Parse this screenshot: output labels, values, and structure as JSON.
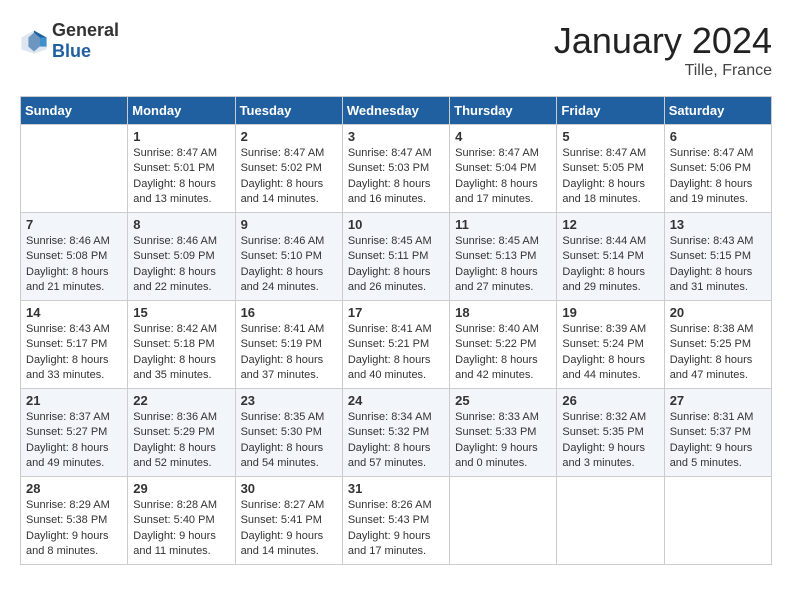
{
  "header": {
    "logo_general": "General",
    "logo_blue": "Blue",
    "month_title": "January 2024",
    "location": "Tille, France"
  },
  "weekdays": [
    "Sunday",
    "Monday",
    "Tuesday",
    "Wednesday",
    "Thursday",
    "Friday",
    "Saturday"
  ],
  "weeks": [
    [
      {
        "day": "",
        "sunrise": "",
        "sunset": "",
        "daylight": ""
      },
      {
        "day": "1",
        "sunrise": "Sunrise: 8:47 AM",
        "sunset": "Sunset: 5:01 PM",
        "daylight": "Daylight: 8 hours and 13 minutes."
      },
      {
        "day": "2",
        "sunrise": "Sunrise: 8:47 AM",
        "sunset": "Sunset: 5:02 PM",
        "daylight": "Daylight: 8 hours and 14 minutes."
      },
      {
        "day": "3",
        "sunrise": "Sunrise: 8:47 AM",
        "sunset": "Sunset: 5:03 PM",
        "daylight": "Daylight: 8 hours and 16 minutes."
      },
      {
        "day": "4",
        "sunrise": "Sunrise: 8:47 AM",
        "sunset": "Sunset: 5:04 PM",
        "daylight": "Daylight: 8 hours and 17 minutes."
      },
      {
        "day": "5",
        "sunrise": "Sunrise: 8:47 AM",
        "sunset": "Sunset: 5:05 PM",
        "daylight": "Daylight: 8 hours and 18 minutes."
      },
      {
        "day": "6",
        "sunrise": "Sunrise: 8:47 AM",
        "sunset": "Sunset: 5:06 PM",
        "daylight": "Daylight: 8 hours and 19 minutes."
      }
    ],
    [
      {
        "day": "7",
        "sunrise": "Sunrise: 8:46 AM",
        "sunset": "Sunset: 5:08 PM",
        "daylight": "Daylight: 8 hours and 21 minutes."
      },
      {
        "day": "8",
        "sunrise": "Sunrise: 8:46 AM",
        "sunset": "Sunset: 5:09 PM",
        "daylight": "Daylight: 8 hours and 22 minutes."
      },
      {
        "day": "9",
        "sunrise": "Sunrise: 8:46 AM",
        "sunset": "Sunset: 5:10 PM",
        "daylight": "Daylight: 8 hours and 24 minutes."
      },
      {
        "day": "10",
        "sunrise": "Sunrise: 8:45 AM",
        "sunset": "Sunset: 5:11 PM",
        "daylight": "Daylight: 8 hours and 26 minutes."
      },
      {
        "day": "11",
        "sunrise": "Sunrise: 8:45 AM",
        "sunset": "Sunset: 5:13 PM",
        "daylight": "Daylight: 8 hours and 27 minutes."
      },
      {
        "day": "12",
        "sunrise": "Sunrise: 8:44 AM",
        "sunset": "Sunset: 5:14 PM",
        "daylight": "Daylight: 8 hours and 29 minutes."
      },
      {
        "day": "13",
        "sunrise": "Sunrise: 8:43 AM",
        "sunset": "Sunset: 5:15 PM",
        "daylight": "Daylight: 8 hours and 31 minutes."
      }
    ],
    [
      {
        "day": "14",
        "sunrise": "Sunrise: 8:43 AM",
        "sunset": "Sunset: 5:17 PM",
        "daylight": "Daylight: 8 hours and 33 minutes."
      },
      {
        "day": "15",
        "sunrise": "Sunrise: 8:42 AM",
        "sunset": "Sunset: 5:18 PM",
        "daylight": "Daylight: 8 hours and 35 minutes."
      },
      {
        "day": "16",
        "sunrise": "Sunrise: 8:41 AM",
        "sunset": "Sunset: 5:19 PM",
        "daylight": "Daylight: 8 hours and 37 minutes."
      },
      {
        "day": "17",
        "sunrise": "Sunrise: 8:41 AM",
        "sunset": "Sunset: 5:21 PM",
        "daylight": "Daylight: 8 hours and 40 minutes."
      },
      {
        "day": "18",
        "sunrise": "Sunrise: 8:40 AM",
        "sunset": "Sunset: 5:22 PM",
        "daylight": "Daylight: 8 hours and 42 minutes."
      },
      {
        "day": "19",
        "sunrise": "Sunrise: 8:39 AM",
        "sunset": "Sunset: 5:24 PM",
        "daylight": "Daylight: 8 hours and 44 minutes."
      },
      {
        "day": "20",
        "sunrise": "Sunrise: 8:38 AM",
        "sunset": "Sunset: 5:25 PM",
        "daylight": "Daylight: 8 hours and 47 minutes."
      }
    ],
    [
      {
        "day": "21",
        "sunrise": "Sunrise: 8:37 AM",
        "sunset": "Sunset: 5:27 PM",
        "daylight": "Daylight: 8 hours and 49 minutes."
      },
      {
        "day": "22",
        "sunrise": "Sunrise: 8:36 AM",
        "sunset": "Sunset: 5:29 PM",
        "daylight": "Daylight: 8 hours and 52 minutes."
      },
      {
        "day": "23",
        "sunrise": "Sunrise: 8:35 AM",
        "sunset": "Sunset: 5:30 PM",
        "daylight": "Daylight: 8 hours and 54 minutes."
      },
      {
        "day": "24",
        "sunrise": "Sunrise: 8:34 AM",
        "sunset": "Sunset: 5:32 PM",
        "daylight": "Daylight: 8 hours and 57 minutes."
      },
      {
        "day": "25",
        "sunrise": "Sunrise: 8:33 AM",
        "sunset": "Sunset: 5:33 PM",
        "daylight": "Daylight: 9 hours and 0 minutes."
      },
      {
        "day": "26",
        "sunrise": "Sunrise: 8:32 AM",
        "sunset": "Sunset: 5:35 PM",
        "daylight": "Daylight: 9 hours and 3 minutes."
      },
      {
        "day": "27",
        "sunrise": "Sunrise: 8:31 AM",
        "sunset": "Sunset: 5:37 PM",
        "daylight": "Daylight: 9 hours and 5 minutes."
      }
    ],
    [
      {
        "day": "28",
        "sunrise": "Sunrise: 8:29 AM",
        "sunset": "Sunset: 5:38 PM",
        "daylight": "Daylight: 9 hours and 8 minutes."
      },
      {
        "day": "29",
        "sunrise": "Sunrise: 8:28 AM",
        "sunset": "Sunset: 5:40 PM",
        "daylight": "Daylight: 9 hours and 11 minutes."
      },
      {
        "day": "30",
        "sunrise": "Sunrise: 8:27 AM",
        "sunset": "Sunset: 5:41 PM",
        "daylight": "Daylight: 9 hours and 14 minutes."
      },
      {
        "day": "31",
        "sunrise": "Sunrise: 8:26 AM",
        "sunset": "Sunset: 5:43 PM",
        "daylight": "Daylight: 9 hours and 17 minutes."
      },
      {
        "day": "",
        "sunrise": "",
        "sunset": "",
        "daylight": ""
      },
      {
        "day": "",
        "sunrise": "",
        "sunset": "",
        "daylight": ""
      },
      {
        "day": "",
        "sunrise": "",
        "sunset": "",
        "daylight": ""
      }
    ]
  ]
}
